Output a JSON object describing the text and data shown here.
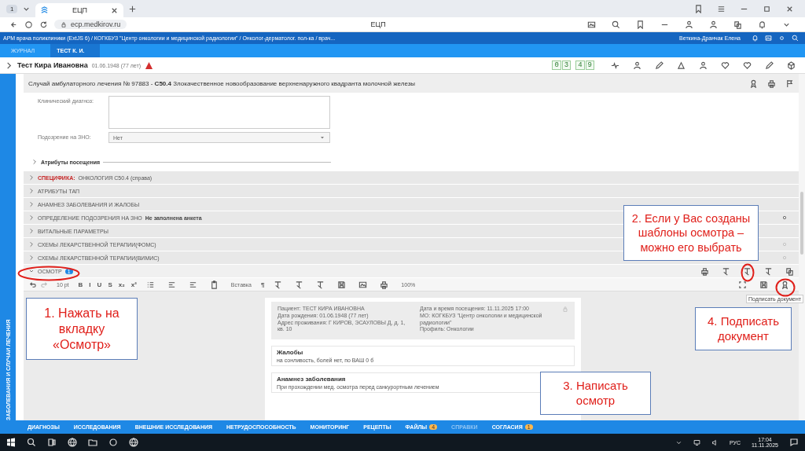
{
  "browser": {
    "tab_count": "1",
    "tab_title": "ЕЦП",
    "url": "ecp.medkirov.ru",
    "page_title": "ЕЦП"
  },
  "app_bar": {
    "breadcrumb": "АРМ врача поликлиники (ExtJS 6) / КОГКБУЗ \"Центр онкологии и медицинской радиологии\" / Онколог-дерматолог. пол-ка / врач...",
    "user": "Веткина-Дранчак Елена"
  },
  "tabs": [
    {
      "label": "ЖУРНАЛ",
      "selected": false
    },
    {
      "label": "ТЕСТ К. И.",
      "selected": true
    }
  ],
  "patient": {
    "name": "Тест Кира Ивановна",
    "birth": "01.06.1948 (77 лет)",
    "timer": [
      "0",
      "3",
      "4",
      "9"
    ]
  },
  "case_title": "Случай амбулаторного лечения № 97883 - **C50.4** Злокачественное новообразование верхненаружного квадранта молочной железы",
  "sidebar": {
    "label": "ЗАБОЛЕВАНИЯ И СЛУЧАИ ЛЕЧЕНИЯ"
  },
  "form": {
    "fields": [
      {
        "kind": "textarea",
        "label": "Клинический диагноз:"
      },
      {
        "kind": "select",
        "label": "Подозрение на ЗНО:",
        "value": "Нет"
      }
    ],
    "section": "Атрибуты посещения"
  },
  "sections": [
    {
      "tag": "СПЕЦИФИКА:",
      "label": "ОНКОЛОГИЯ С50.4 (справа)"
    },
    {
      "label": "АТРИБУТЫ ТАП"
    },
    {
      "label": "АНАМНЕЗ ЗАБОЛЕВАНИЯ И ЖАЛОБЫ"
    },
    {
      "label": "ОПРЕДЕЛЕНИЕ ПОДОЗРЕНИЯ НА ЗНО",
      "note": "Не заполнена анкета",
      "icon": {
        "disabled": false
      }
    },
    {
      "label": "ВИТАЛЬНЫЕ ПАРАМЕТРЫ"
    },
    {
      "label": "СХЕМЫ ЛЕКАРСТВЕННОЙ ТЕРАПИИ(ФОМС)",
      "icon": {
        "disabled": true
      }
    },
    {
      "label": "СХЕМЫ ЛЕКАРСТВЕННОЙ ТЕРАПИИ(ВИМИС)",
      "icon": {
        "disabled": true
      }
    }
  ],
  "exam": {
    "label": "ОСМОТР",
    "badge": "1",
    "expanded": true
  },
  "toolbar": {
    "font_size": "10 pt",
    "glyphs": [
      "B",
      "I",
      "U",
      "S",
      "x₂",
      "x²"
    ],
    "insert": "Вставка",
    "pilcrow": "¶",
    "zoom": "100%"
  },
  "document": {
    "header_left": [
      "Пациент: ТЕСТ КИРА ИВАНОВНА",
      "Дата рождения: 01.06.1948 (77 лет)",
      "Адрес проживания: Г КИРОВ, ЭСАУЛОВЫ Д, д. 1, кв. 10"
    ],
    "header_right": [
      "Дата и время посещения: 11.11.2025 17:00",
      "МО: КОГКБУЗ \"Центр онкологии и медицинской радиологии\"",
      "Профиль: Онкологии"
    ],
    "sections": [
      {
        "title": "Жалобы",
        "text": "на сонливость, болей нет, по ВАШ 0 б"
      },
      {
        "title": "Анамнез заболевания",
        "text": "При прохождении мед. осмотра перед санкурортным лечением"
      }
    ]
  },
  "tooltip": "Подписать документ",
  "annotations": [
    "1. Нажать на вкладку «Осмотр»",
    "2. Если у Вас созданы шаблоны осмотра – можно его выбрать",
    "3. Написать осмотр",
    "4. Подписать документ"
  ],
  "bottom_tabs": [
    {
      "label": "ДИАГНОЗЫ",
      "disabled": false
    },
    {
      "label": "ИССЛЕДОВАНИЯ",
      "disabled": false
    },
    {
      "label": "ВНЕШНИЕ ИССЛЕДОВАНИЯ",
      "disabled": false
    },
    {
      "label": "НЕТРУДОСПОСОБНОСТЬ",
      "disabled": false
    },
    {
      "label": "МОНИТОРИНГ",
      "disabled": false
    },
    {
      "label": "РЕЦЕПТЫ",
      "disabled": false
    },
    {
      "label": "ФАЙЛЫ",
      "badge": "4",
      "disabled": false
    },
    {
      "label": "СПРАВКИ",
      "disabled": true
    },
    {
      "label": "СОГЛАСИЯ",
      "badge": "1",
      "disabled": false
    }
  ],
  "taskbar": {
    "lang": "РУС",
    "time": "17:04",
    "date": "11.11.2025"
  }
}
